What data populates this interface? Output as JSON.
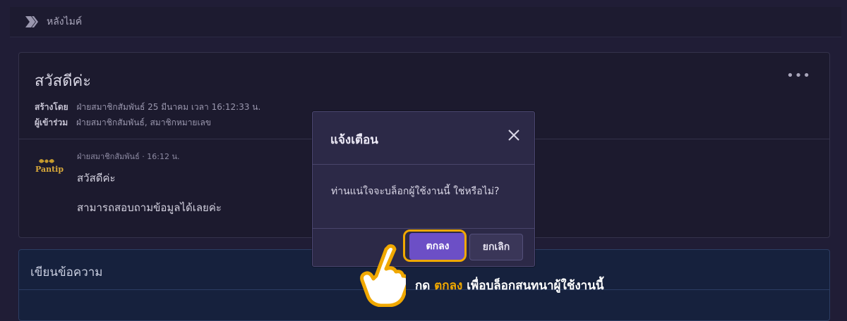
{
  "topbar": {
    "crumb": "หลังไมค์"
  },
  "chat": {
    "title": "สวัสดีค่ะ",
    "more": "•••",
    "created_by_label": "สร้างโดย",
    "created_by_value": "ฝ่ายสมาชิกสัมพันธ์ 25 มีนาคม เวลา 16:12:33 น.",
    "participants_label": "ผู้เข้าร่วม",
    "participants_value": "ฝ่ายสมาชิกสัมพันธ์, สมาชิกหมายเลข",
    "message": {
      "author_time": "ฝ่ายสมาชิกสัมพันธ์ · 16:12 น.",
      "line1": "สวัสดีค่ะ",
      "line2": "สามารถสอบถามข้อมูลได้เลยค่ะ",
      "avatar_text": "Pantip"
    }
  },
  "compose": {
    "label": "เขียนข้อความ"
  },
  "modal": {
    "title": "แจ้งเตือน",
    "message": "ท่านแน่ใจจะบล็อกผู้ใช้งานนี้ ใช่หรือไม่?",
    "ok_label": "ตกลง",
    "cancel_label": "ยกเลิก"
  },
  "instruction": {
    "prefix": "กด",
    "highlight": "ตกลง",
    "suffix": "เพื่อบล็อกสนทนาผู้ใช้งานนี้"
  },
  "colors": {
    "background": "#201d36",
    "modal_bg": "#2c2947",
    "ok_button": "#6c4fc6",
    "highlight": "#f0a800"
  }
}
